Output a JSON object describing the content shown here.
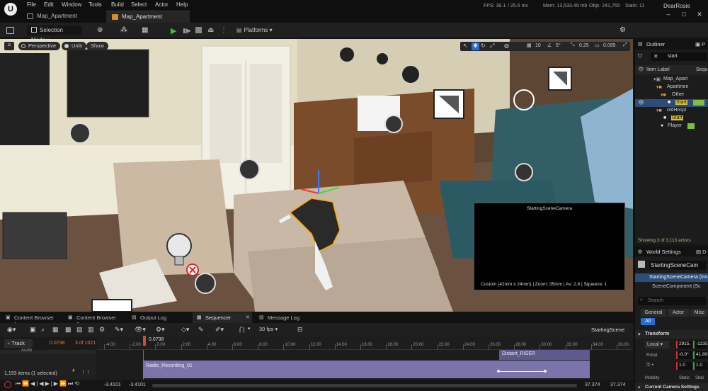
{
  "menu": [
    "File",
    "Edit",
    "Window",
    "Tools",
    "Build",
    "Select",
    "Actor",
    "Help"
  ],
  "doc_tabs": [
    "Map_Apartment",
    "Map_Apartment"
  ],
  "stats": {
    "fps": "FPS: 39.1",
    "ms": "/ 25.6 ms",
    "mem": "Mem: 13,533.49 mb",
    "objs": "Objs: 241,765",
    "stats": "Stats: 11",
    "user": "DearRosie"
  },
  "toolbar": {
    "selection_mode": "Selection Mode",
    "platforms": "Platforms"
  },
  "viewport": {
    "perspective": "Perspective",
    "unlit": "Unlit",
    "show": "Show",
    "grid_size": "10",
    "angle": "5°",
    "scale": "0.25",
    "camera_speed": "0.095",
    "camera_preview_title": "StartingSceneCamera",
    "camera_preview_info": "Custom (42mm x 24mm) | Zoom: 35mm | Av: 2.8 | Squeeze: 1"
  },
  "outliner": {
    "title": "Outliner",
    "search_value": "start",
    "col_label": "Item Label",
    "col_seq": "Sequ",
    "rows": [
      {
        "label": "Map_Apart",
        "indent": 0,
        "icon": "map-icon"
      },
      {
        "label": "Apartmen",
        "indent": 1,
        "icon": "folder-icon"
      },
      {
        "label": "Other",
        "indent": 2,
        "icon": "folder-icon"
      },
      {
        "label": "Start",
        "indent": 3,
        "icon": "camera-icon",
        "selected": true
      },
      {
        "label": "oldHospi",
        "indent": 1,
        "icon": "folder-icon"
      },
      {
        "label": "Start",
        "indent": 2,
        "icon": "camera-icon"
      },
      {
        "label": "Player",
        "indent": 2,
        "icon": "actor-icon"
      }
    ],
    "status": "Showing 3 of 3,113 actors"
  },
  "details": {
    "world_settings": "World Settings",
    "tab2": "D",
    "actor_name": "StartingSceneCam",
    "component_root": "StartingSceneCamera (Ins",
    "component_child": "SceneComponent (Sc",
    "search_placeholder": "Search",
    "filter_tabs": [
      "General",
      "Actor",
      "Misc",
      "All"
    ],
    "transform_header": "Transform",
    "location_mode": "Local",
    "location_values": [
      "2915.",
      "-1235"
    ],
    "rotation_label": "Rotat",
    "rotation_values": [
      "-0.0°",
      "41.80"
    ],
    "scale_values": [
      "1.0",
      "1.0"
    ],
    "mobility_label": "Mobility",
    "mobility_values": [
      "Static",
      "Stati"
    ],
    "camera_settings": "Current Camera Settings"
  },
  "bottom_tabs": [
    "Content Browser 1",
    "Content Browser 2",
    "Output Log",
    "Sequencer",
    "Message Log"
  ],
  "sequencer": {
    "fps": "30 fps",
    "scene_name": "StartingScene",
    "track_btn": "Track",
    "current_time": "0.0738",
    "frame_info": "3 of 1021",
    "playhead": "0.0738",
    "ticks": [
      "-4.00",
      "-2.00",
      "0.00",
      "2.00",
      "4.00",
      "6.00",
      "8.00",
      "10.00",
      "12.00",
      "14.00",
      "16.00",
      "18.00",
      "20.00",
      "22.00",
      "24.00",
      "26.00",
      "28.00",
      "30.00",
      "32.00",
      "34.00",
      "36.00"
    ],
    "track_audio": "Audio",
    "clip1": "Radio_Recording_01",
    "clip2": "Distant_RISER",
    "items_selected": "1,193 items (1 selected)",
    "time_left_1": "-3.4101",
    "time_left_2": "-3.4101",
    "time_right_1": "37.374",
    "time_right_2": "37.374"
  }
}
